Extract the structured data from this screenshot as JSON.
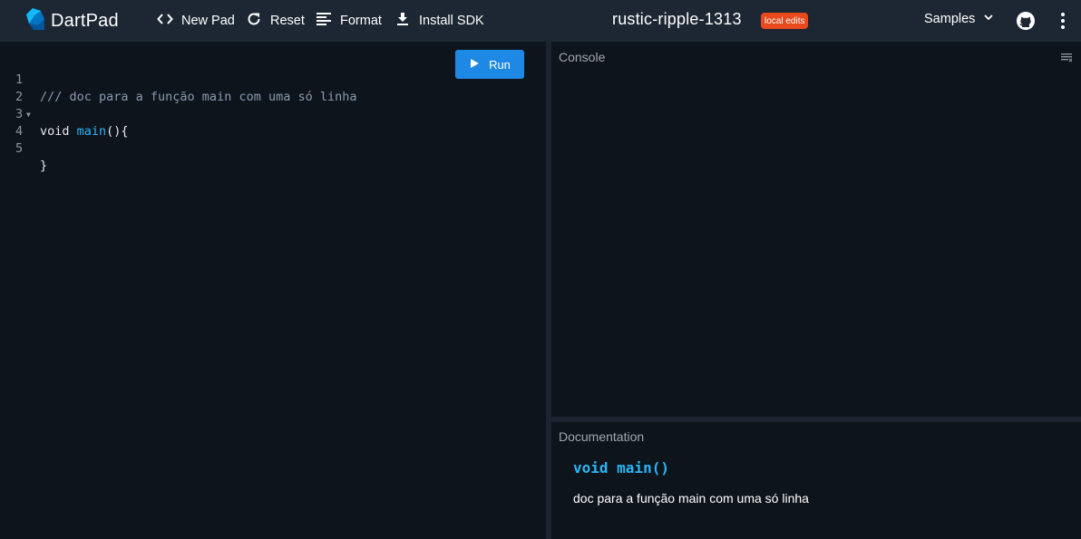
{
  "app": {
    "name": "DartPad"
  },
  "toolbar": {
    "new_pad": "New Pad",
    "reset": "Reset",
    "format": "Format",
    "install_sdk": "Install SDK",
    "pad_title": "rustic-ripple-1313",
    "edits_badge": "local edits",
    "samples": "Samples"
  },
  "editor": {
    "run_label": "Run",
    "lines": [
      {
        "num": "1",
        "text": "/// doc para a função main com uma só linha"
      },
      {
        "num": "2",
        "text": "void main(){"
      },
      {
        "num": "3",
        "text": ""
      },
      {
        "num": "4",
        "text": ""
      },
      {
        "num": "5",
        "text": "}"
      }
    ],
    "line2_keyword": "void ",
    "line2_fn": "main",
    "line2_rest": "(){"
  },
  "console": {
    "label": "Console"
  },
  "documentation": {
    "label": "Documentation",
    "signature": "void main()",
    "text": "doc para a função main com uma só linha"
  },
  "icons": {
    "brand": "dart-logo-icon",
    "new_pad": "code-brackets-icon",
    "reset": "refresh-icon",
    "format": "format-lines-icon",
    "install_sdk": "download-icon",
    "samples_chevron": "chevron-down-icon",
    "github": "github-icon",
    "more": "more-vert-icon",
    "run": "play-icon",
    "clear_console": "clear-console-icon"
  },
  "colors": {
    "topbar": "#1d2733",
    "background": "#0e141c",
    "accent": "#1e88e5",
    "badge": "#e8491d",
    "function": "#29b6f6",
    "comment": "#8a9ab0"
  }
}
